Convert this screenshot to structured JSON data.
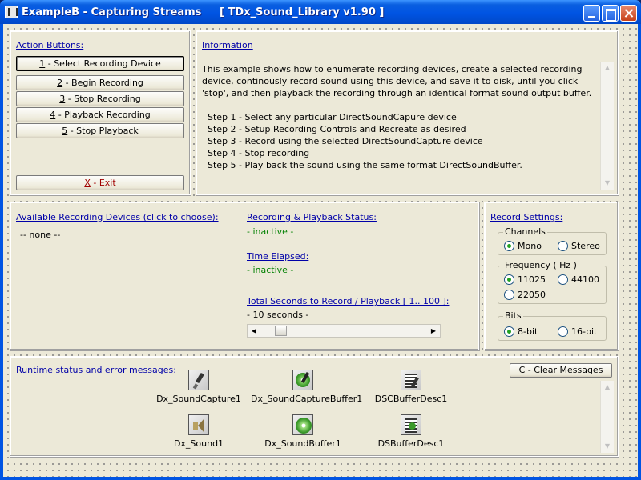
{
  "window": {
    "title": "ExampleB - Capturing Streams     [ TDx_Sound_Library v1.90 ]"
  },
  "action_buttons": {
    "heading": "Action Buttons:",
    "items": [
      {
        "key": "1",
        "label": " - Select Recording Device"
      },
      {
        "key": "2",
        "label": " - Begin Recording"
      },
      {
        "key": "3",
        "label": " - Stop Recording"
      },
      {
        "key": "4",
        "label": " - Playback Recording"
      },
      {
        "key": "5",
        "label": " - Stop Playback"
      }
    ],
    "exit": {
      "key": "X",
      "label": " - Exit"
    }
  },
  "information": {
    "heading": "Information",
    "text": "This example shows how to enumerate recording devices, create a selected recording device, continously record sound using this device, and save it to disk, until you click 'stop', and then playback the recording through an identical format sound output buffer.",
    "steps": [
      "Step 1 - Select any particular DirectSoundCapure device",
      "Step 2 - Setup Recording Controls and Recreate as desired",
      "Step 3 - Record using the selected DirectSoundCapture device",
      "Step 4 - Stop recording",
      "Step 5 - Play back the sound using the same format DirectSoundBuffer."
    ]
  },
  "devices": {
    "heading": "Available Recording Devices (click to choose):",
    "items": [
      "-- none --"
    ]
  },
  "status": {
    "heading": "Recording & Playback Status:",
    "value": "- inactive -",
    "elapsed_heading": "Time Elapsed:",
    "elapsed_value": "- inactive -",
    "total_heading": "Total Seconds to Record / Playback [ 1.. 100 ]:",
    "total_value": "- 10 seconds -",
    "slider_level": 10,
    "slider_range": [
      1,
      100
    ]
  },
  "record_settings": {
    "heading": "Record Settings:",
    "channels": {
      "title": "Channels",
      "options": [
        "Mono",
        "Stereo"
      ],
      "selected": "Mono"
    },
    "frequency": {
      "title": "Frequency ( Hz )",
      "options": [
        "11025",
        "44100",
        "22050"
      ],
      "selected": "11025"
    },
    "bits": {
      "title": "Bits",
      "options": [
        "8-bit",
        "16-bit"
      ],
      "selected": "8-bit"
    }
  },
  "runtime": {
    "heading": "Runtime status and error messages:",
    "clear_key": "C",
    "clear_label": " - Clear Messages",
    "components": [
      {
        "name": "Dx_SoundCapture1",
        "icon": "microphone-icon"
      },
      {
        "name": "Dx_SoundCaptureBuffer1",
        "icon": "microphone-disc-icon"
      },
      {
        "name": "DSCBufferDesc1",
        "icon": "capture-buffer-desc-icon"
      },
      {
        "name": "Dx_Sound1",
        "icon": "speaker-icon"
      },
      {
        "name": "Dx_SoundBuffer1",
        "icon": "disc-icon"
      },
      {
        "name": "DSBufferDesc1",
        "icon": "buffer-desc-icon"
      }
    ]
  }
}
